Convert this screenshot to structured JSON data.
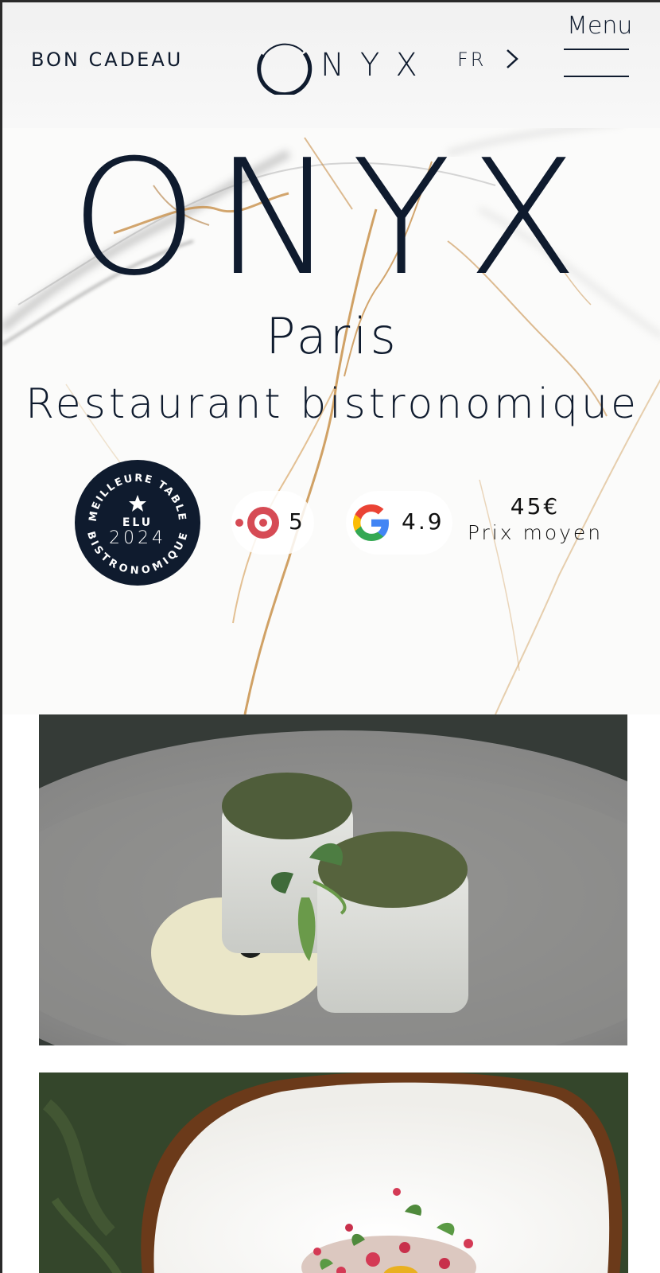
{
  "header": {
    "gift_label": "BON CADEAU",
    "logo_text": "NYX",
    "language": "FR",
    "menu_label": "Menu"
  },
  "hero": {
    "title": "ONYX",
    "city": "Paris",
    "subtitle": "Restaurant bistronomique"
  },
  "award": {
    "top_text": "MEILLEURE TABLE",
    "middle_text": "ELU",
    "year": "2024",
    "bottom_text": "BISTRONOMIQUE"
  },
  "ratings": {
    "tripadvisor_score": "5",
    "google_score": "4.9",
    "price_value": "45€",
    "price_label": "Prix moyen"
  },
  "colors": {
    "navy": "#0f1b2e",
    "tripadvisor_red": "#d64b55",
    "marble_gold": "#c8904a"
  },
  "icons": {
    "arrow": "chevron-right-icon",
    "tripadvisor": "tripadvisor-icon",
    "google": "google-icon"
  }
}
